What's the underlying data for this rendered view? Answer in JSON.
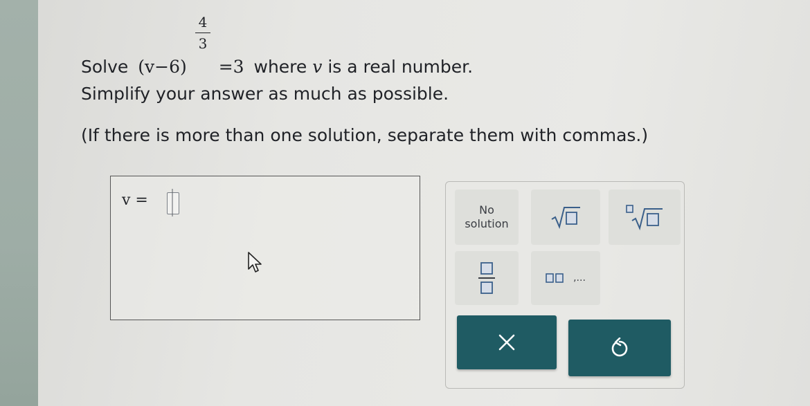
{
  "question": {
    "solve_word": "Solve",
    "equation_base": "(v−6)",
    "exponent_numerator": "4",
    "exponent_denominator": "3",
    "equation_rhs": "=3",
    "where_text": "where",
    "variable": "v",
    "is_real_text": "is a real number.",
    "simplify_text": "Simplify your answer as much as possible.",
    "instruction_text": "(If there is more than one solution, separate them with commas.)"
  },
  "answer": {
    "label": "v =",
    "value": ""
  },
  "palette": {
    "no_solution_line1": "No",
    "no_solution_line2": "solution",
    "list_ellipsis": ",..."
  },
  "colors": {
    "button_bg": "#1f5b63",
    "button_fg": "#ffffff",
    "placeholder_square": "#3a5f8a"
  },
  "icons": {
    "clear": "x-icon",
    "undo": "undo-icon",
    "sqrt": "square-root-icon",
    "nroot": "nth-root-icon",
    "fraction": "fraction-icon",
    "list": "list-icon",
    "cursor": "mouse-cursor-icon"
  }
}
